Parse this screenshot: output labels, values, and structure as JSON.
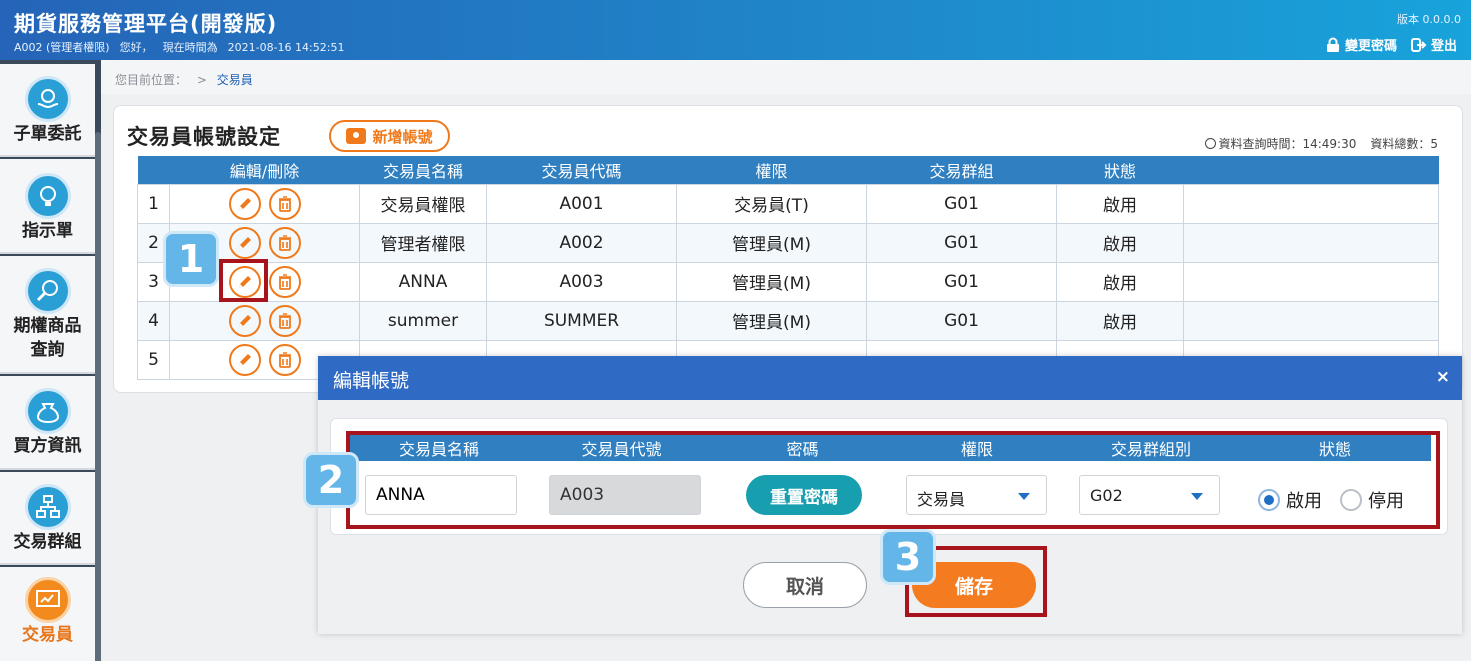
{
  "header": {
    "title": "期貨服務管理平台(開發版)",
    "user": "A002 (管理者權限)",
    "greeting": "您好，",
    "time_label": "現在時間為",
    "datetime": "2021-08-16 14:52:51",
    "version": "版本 0.0.0.0",
    "change_password": "變更密碼",
    "logout": "登出"
  },
  "sidebar": {
    "items": [
      {
        "label": "子單委託",
        "icon": "hands-money-icon"
      },
      {
        "label": "指示單",
        "icon": "lightbulb-money-icon"
      },
      {
        "label": "期權商品查詢",
        "icon": "magnifier-icon"
      },
      {
        "label": "買方資訊",
        "icon": "moneybag-icon"
      },
      {
        "label": "交易群組",
        "icon": "org-chart-icon"
      },
      {
        "label": "交易員",
        "icon": "monitor-icon"
      }
    ]
  },
  "breadcrumb": {
    "prefix": "您目前位置：",
    "sep": ">",
    "current": "交易員"
  },
  "page": {
    "title": "交易員帳號設定",
    "add_button": "新增帳號",
    "query_time_label": "資料查詢時間：14:49:30",
    "total_label": "資料總數：5"
  },
  "table": {
    "headers": [
      "",
      "編輯/刪除",
      "交易員名稱",
      "交易員代碼",
      "權限",
      "交易群組",
      "狀態",
      ""
    ],
    "rows": [
      {
        "no": "1",
        "name": "交易員權限",
        "code": "A001",
        "role": "交易員(T)",
        "group": "G01",
        "status": "啟用"
      },
      {
        "no": "2",
        "name": "管理者權限",
        "code": "A002",
        "role": "管理員(M)",
        "group": "G01",
        "status": "啟用"
      },
      {
        "no": "3",
        "name": "ANNA",
        "code": "A003",
        "role": "管理員(M)",
        "group": "G01",
        "status": "啟用"
      },
      {
        "no": "4",
        "name": "summer",
        "code": "SUMMER",
        "role": "管理員(M)",
        "group": "G01",
        "status": "啟用"
      },
      {
        "no": "5",
        "name": "",
        "code": "",
        "role": "",
        "group": "",
        "status": ""
      }
    ]
  },
  "modal": {
    "title": "編輯帳號",
    "close": "×",
    "headers": [
      "交易員名稱",
      "交易員代號",
      "密碼",
      "權限",
      "交易群組別",
      "狀態"
    ],
    "name_value": "ANNA",
    "code_value": "A003",
    "reset_password": "重置密碼",
    "role_value": "交易員",
    "group_value": "G02",
    "status_on": "啟用",
    "status_off": "停用",
    "cancel": "取消",
    "save": "儲存"
  },
  "annotations": {
    "step1": "1",
    "step2": "2",
    "step3": "3",
    "highlight_color": "#a8141b",
    "badge_color": "#65b6e8"
  },
  "colors": {
    "brand_blue": "#2f7fc1",
    "accent_orange": "#f07a1b",
    "teal": "#179fb0"
  }
}
